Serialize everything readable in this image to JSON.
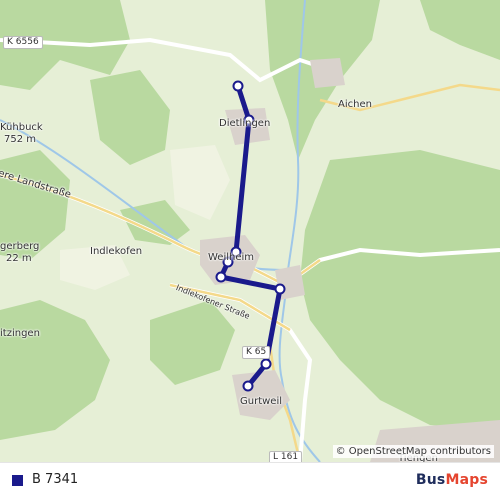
{
  "map": {
    "labels": {
      "k6556": "K 6556",
      "aichen": "Aichen",
      "dietlingen": "Dietlingen",
      "kuhbuck": "Kühbuck",
      "kuhbuck_elev": "752 m",
      "landstrasse": "ere Landstraße",
      "indlekofen": "Indlekofen",
      "weilheim": "Weilheim",
      "bergerberg": "gerberg",
      "bergerberg_elev": "22 m",
      "indlekofener_strasse": "Indlekofener Straße",
      "itzingen": "itzingen",
      "k65": "K 65",
      "gurtweil": "Gurtweil",
      "l161": "L 161",
      "tiengen": "Tiengen"
    },
    "attribution": "© OpenStreetMap contributors",
    "route_color": "#1a1a8c"
  },
  "legend": {
    "route_label": "B 7341",
    "swatch_color": "#1a1a8c"
  },
  "brand": {
    "part1": "Bus",
    "part2": "Maps"
  }
}
